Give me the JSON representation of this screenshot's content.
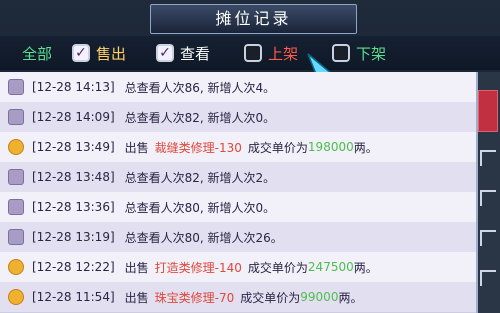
{
  "window": {
    "title": "摊位记录"
  },
  "filters": [
    {
      "label": "全部",
      "checked": false,
      "color": "#59e08f"
    },
    {
      "label": "售出",
      "checked": true,
      "color": "#ffd166"
    },
    {
      "label": "查看",
      "checked": true,
      "color": "#ffffff"
    },
    {
      "label": "上架",
      "checked": false,
      "color": "#ff5a4a"
    },
    {
      "label": "下架",
      "checked": false,
      "color": "#59e08f"
    }
  ],
  "records": [
    {
      "icon": "view-icon",
      "time": "[12-28 14:13]",
      "text": "总查看人次86, 新增人次4。"
    },
    {
      "icon": "view-icon",
      "time": "[12-28 14:09]",
      "text": "总查看人次82, 新增人次0。"
    },
    {
      "icon": "sale-icon",
      "time": "[12-28 13:49]",
      "prefix": "出售",
      "item": "裁缝类修理-130",
      "mid": "成交单价为",
      "price": "198000",
      "suffix": "两。"
    },
    {
      "icon": "view-icon",
      "time": "[12-28 13:48]",
      "text": "总查看人次82, 新增人次2。"
    },
    {
      "icon": "view-icon",
      "time": "[12-28 13:36]",
      "text": "总查看人次80, 新增人次0。"
    },
    {
      "icon": "view-icon",
      "time": "[12-28 13:19]",
      "text": "总查看人次80, 新增人次26。"
    },
    {
      "icon": "sale-icon",
      "time": "[12-28 12:22]",
      "prefix": "出售",
      "item": "打造类修理-140",
      "mid": "成交单价为",
      "price": "247500",
      "suffix": "两。"
    },
    {
      "icon": "sale-icon",
      "time": "[12-28 11:54]",
      "prefix": "出售",
      "item": "珠宝类修理-70",
      "mid": "成交单价为",
      "price": "99000",
      "suffix": "两。"
    }
  ]
}
